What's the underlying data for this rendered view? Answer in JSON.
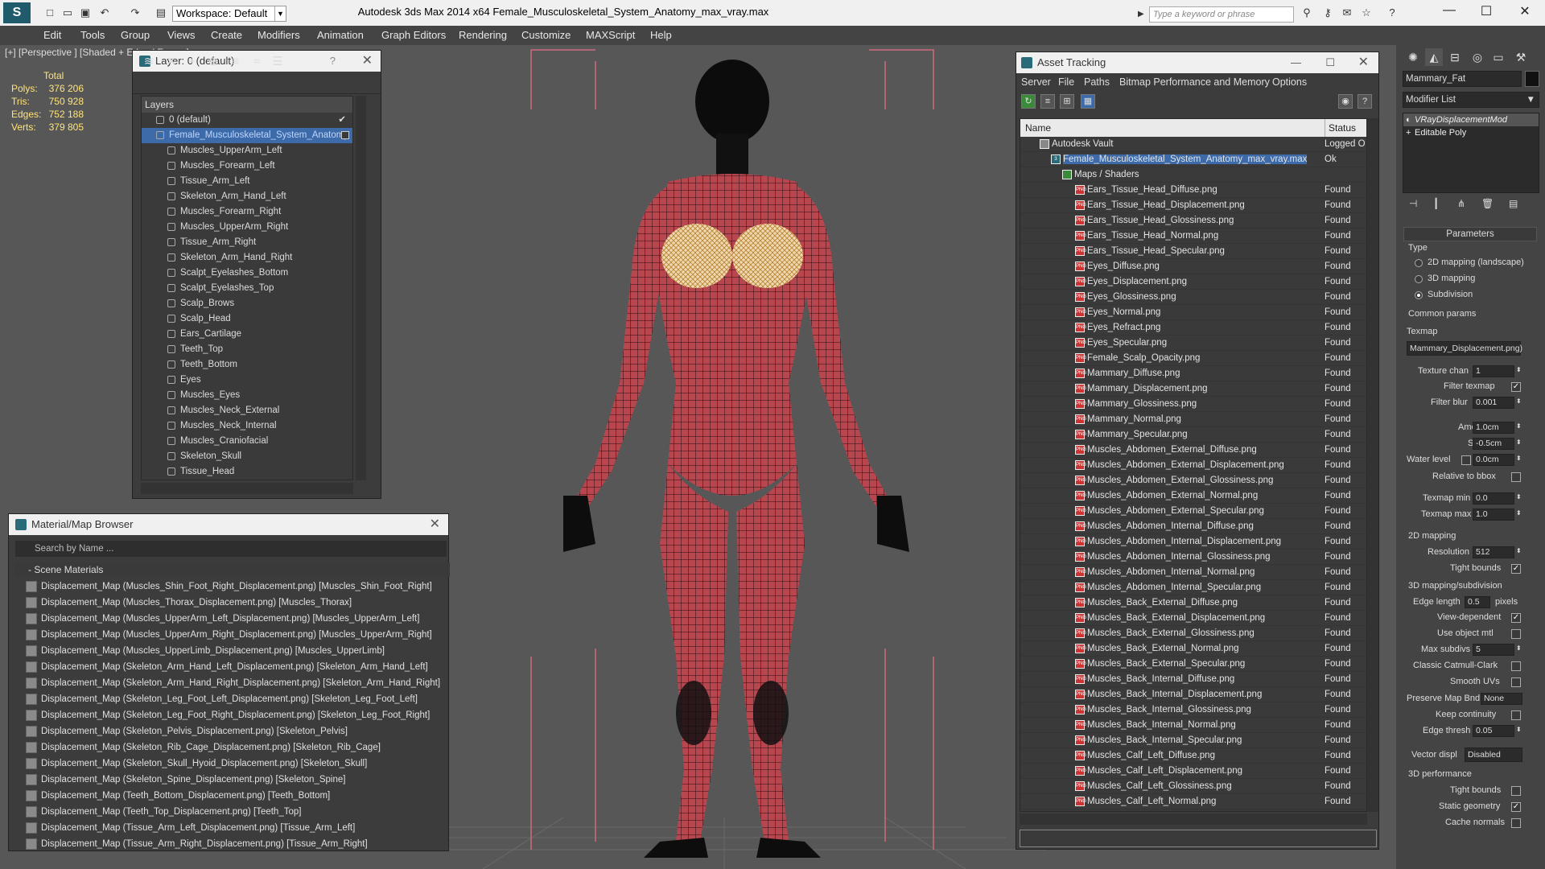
{
  "app": {
    "title": "Autodesk 3ds Max  2014 x64     Female_Musculoskeletal_System_Anatomy_max_vray.max",
    "workspace": "Workspace: Default",
    "search_placeholder": "Type a keyword or phrase"
  },
  "menu": [
    "Edit",
    "Tools",
    "Group",
    "Views",
    "Create",
    "Modifiers",
    "Animation",
    "Graph Editors",
    "Rendering",
    "Customize",
    "MAXScript",
    "Help"
  ],
  "viewport": {
    "label": "[+] [Perspective ] [Shaded + Edged Faces ]",
    "stats": {
      "header": "Total",
      "rows": [
        {
          "label": "Polys:",
          "value": "376 206"
        },
        {
          "label": "Tris:",
          "value": "750 928"
        },
        {
          "label": "Edges:",
          "value": "752 188"
        },
        {
          "label": "Verts:",
          "value": "379 805"
        }
      ]
    }
  },
  "layer_panel": {
    "title": "Layer: 0 (default)",
    "help": "?",
    "header": "Layers",
    "items": [
      {
        "label": "0 (default)",
        "level": 1,
        "checked": true
      },
      {
        "label": "Female_Musculoskeletal_System_Anatomy",
        "level": 1,
        "selected": true
      },
      {
        "label": "Muscles_UpperArm_Left",
        "level": 2
      },
      {
        "label": "Muscles_Forearm_Left",
        "level": 2
      },
      {
        "label": "Tissue_Arm_Left",
        "level": 2
      },
      {
        "label": "Skeleton_Arm_Hand_Left",
        "level": 2
      },
      {
        "label": "Muscles_Forearm_Right",
        "level": 2
      },
      {
        "label": "Muscles_UpperArm_Right",
        "level": 2
      },
      {
        "label": "Tissue_Arm_Right",
        "level": 2
      },
      {
        "label": "Skeleton_Arm_Hand_Right",
        "level": 2
      },
      {
        "label": "Scalpt_Eyelashes_Bottom",
        "level": 2
      },
      {
        "label": "Scalpt_Eyelashes_Top",
        "level": 2
      },
      {
        "label": "Scalp_Brows",
        "level": 2
      },
      {
        "label": "Scalp_Head",
        "level": 2
      },
      {
        "label": "Ears_Cartilage",
        "level": 2
      },
      {
        "label": "Teeth_Top",
        "level": 2
      },
      {
        "label": "Teeth_Bottom",
        "level": 2
      },
      {
        "label": "Eyes",
        "level": 2
      },
      {
        "label": "Muscles_Eyes",
        "level": 2
      },
      {
        "label": "Muscles_Neck_External",
        "level": 2
      },
      {
        "label": "Muscles_Neck_Internal",
        "level": 2
      },
      {
        "label": "Muscles_Craniofacial",
        "level": 2
      },
      {
        "label": "Skeleton_Skull",
        "level": 2
      },
      {
        "label": "Tissue_Head",
        "level": 2
      }
    ]
  },
  "material_browser": {
    "title": "Material/Map Browser",
    "search_placeholder": "Search by Name ...",
    "section": "Scene Materials",
    "items": [
      "Displacement_Map (Muscles_Shin_Foot_Right_Displacement.png) [Muscles_Shin_Foot_Right]",
      "Displacement_Map (Muscles_Thorax_Displacement.png) [Muscles_Thorax]",
      "Displacement_Map (Muscles_UpperArm_Left_Displacement.png) [Muscles_UpperArm_Left]",
      "Displacement_Map (Muscles_UpperArm_Right_Displacement.png) [Muscles_UpperArm_Right]",
      "Displacement_Map (Muscles_UpperLimb_Displacement.png) [Muscles_UpperLimb]",
      "Displacement_Map (Skeleton_Arm_Hand_Left_Displacement.png) [Skeleton_Arm_Hand_Left]",
      "Displacement_Map (Skeleton_Arm_Hand_Right_Displacement.png) [Skeleton_Arm_Hand_Right]",
      "Displacement_Map (Skeleton_Leg_Foot_Left_Displacement.png) [Skeleton_Leg_Foot_Left]",
      "Displacement_Map (Skeleton_Leg_Foot_Right_Displacement.png) [Skeleton_Leg_Foot_Right]",
      "Displacement_Map (Skeleton_Pelvis_Displacement.png) [Skeleton_Pelvis]",
      "Displacement_Map (Skeleton_Rib_Cage_Displacement.png) [Skeleton_Rib_Cage]",
      "Displacement_Map (Skeleton_Skull_Hyoid_Displacement.png) [Skeleton_Skull]",
      "Displacement_Map (Skeleton_Spine_Displacement.png) [Skeleton_Spine]",
      "Displacement_Map (Teeth_Bottom_Displacement.png) [Teeth_Bottom]",
      "Displacement_Map (Teeth_Top_Displacement.png) [Teeth_Top]",
      "Displacement_Map (Tissue_Arm_Left_Displacement.png) [Tissue_Arm_Left]",
      "Displacement_Map (Tissue_Arm_Right_Displacement.png) [Tissue_Arm_Right]"
    ]
  },
  "asset_tracking": {
    "title": "Asset Tracking",
    "menu": [
      "Server",
      "File",
      "Paths",
      "Bitmap Performance and Memory",
      "Options"
    ],
    "columns": {
      "name": "Name",
      "status": "Status"
    },
    "rows": [
      {
        "name": "Autodesk Vault",
        "status": "Logged O",
        "level": 1,
        "icon": "vault"
      },
      {
        "name": "Female_Musculoskeletal_System_Anatomy_max_vray.max",
        "status": "Ok",
        "level": 2,
        "icon": "max",
        "selected": true
      },
      {
        "name": "Maps / Shaders",
        "status": "",
        "level": 3,
        "icon": "folder"
      },
      {
        "name": "Ears_Tissue_Head_Diffuse.png",
        "status": "Found",
        "level": 4,
        "icon": "png"
      },
      {
        "name": "Ears_Tissue_Head_Displacement.png",
        "status": "Found",
        "level": 4,
        "icon": "png"
      },
      {
        "name": "Ears_Tissue_Head_Glossiness.png",
        "status": "Found",
        "level": 4,
        "icon": "png"
      },
      {
        "name": "Ears_Tissue_Head_Normal.png",
        "status": "Found",
        "level": 4,
        "icon": "png"
      },
      {
        "name": "Ears_Tissue_Head_Specular.png",
        "status": "Found",
        "level": 4,
        "icon": "png"
      },
      {
        "name": "Eyes_Diffuse.png",
        "status": "Found",
        "level": 4,
        "icon": "png"
      },
      {
        "name": "Eyes_Displacement.png",
        "status": "Found",
        "level": 4,
        "icon": "png"
      },
      {
        "name": "Eyes_Glossiness.png",
        "status": "Found",
        "level": 4,
        "icon": "png"
      },
      {
        "name": "Eyes_Normal.png",
        "status": "Found",
        "level": 4,
        "icon": "png"
      },
      {
        "name": "Eyes_Refract.png",
        "status": "Found",
        "level": 4,
        "icon": "png"
      },
      {
        "name": "Eyes_Specular.png",
        "status": "Found",
        "level": 4,
        "icon": "png"
      },
      {
        "name": "Female_Scalp_Opacity.png",
        "status": "Found",
        "level": 4,
        "icon": "png"
      },
      {
        "name": "Mammary_Diffuse.png",
        "status": "Found",
        "level": 4,
        "icon": "png"
      },
      {
        "name": "Mammary_Displacement.png",
        "status": "Found",
        "level": 4,
        "icon": "png"
      },
      {
        "name": "Mammary_Glossiness.png",
        "status": "Found",
        "level": 4,
        "icon": "png"
      },
      {
        "name": "Mammary_Normal.png",
        "status": "Found",
        "level": 4,
        "icon": "png"
      },
      {
        "name": "Mammary_Specular.png",
        "status": "Found",
        "level": 4,
        "icon": "png"
      },
      {
        "name": "Muscles_Abdomen_External_Diffuse.png",
        "status": "Found",
        "level": 4,
        "icon": "png"
      },
      {
        "name": "Muscles_Abdomen_External_Displacement.png",
        "status": "Found",
        "level": 4,
        "icon": "png"
      },
      {
        "name": "Muscles_Abdomen_External_Glossiness.png",
        "status": "Found",
        "level": 4,
        "icon": "png"
      },
      {
        "name": "Muscles_Abdomen_External_Normal.png",
        "status": "Found",
        "level": 4,
        "icon": "png"
      },
      {
        "name": "Muscles_Abdomen_External_Specular.png",
        "status": "Found",
        "level": 4,
        "icon": "png"
      },
      {
        "name": "Muscles_Abdomen_Internal_Diffuse.png",
        "status": "Found",
        "level": 4,
        "icon": "png"
      },
      {
        "name": "Muscles_Abdomen_Internal_Displacement.png",
        "status": "Found",
        "level": 4,
        "icon": "png"
      },
      {
        "name": "Muscles_Abdomen_Internal_Glossiness.png",
        "status": "Found",
        "level": 4,
        "icon": "png"
      },
      {
        "name": "Muscles_Abdomen_Internal_Normal.png",
        "status": "Found",
        "level": 4,
        "icon": "png"
      },
      {
        "name": "Muscles_Abdomen_Internal_Specular.png",
        "status": "Found",
        "level": 4,
        "icon": "png"
      },
      {
        "name": "Muscles_Back_External_Diffuse.png",
        "status": "Found",
        "level": 4,
        "icon": "png"
      },
      {
        "name": "Muscles_Back_External_Displacement.png",
        "status": "Found",
        "level": 4,
        "icon": "png"
      },
      {
        "name": "Muscles_Back_External_Glossiness.png",
        "status": "Found",
        "level": 4,
        "icon": "png"
      },
      {
        "name": "Muscles_Back_External_Normal.png",
        "status": "Found",
        "level": 4,
        "icon": "png"
      },
      {
        "name": "Muscles_Back_External_Specular.png",
        "status": "Found",
        "level": 4,
        "icon": "png"
      },
      {
        "name": "Muscles_Back_Internal_Diffuse.png",
        "status": "Found",
        "level": 4,
        "icon": "png"
      },
      {
        "name": "Muscles_Back_Internal_Displacement.png",
        "status": "Found",
        "level": 4,
        "icon": "png"
      },
      {
        "name": "Muscles_Back_Internal_Glossiness.png",
        "status": "Found",
        "level": 4,
        "icon": "png"
      },
      {
        "name": "Muscles_Back_Internal_Normal.png",
        "status": "Found",
        "level": 4,
        "icon": "png"
      },
      {
        "name": "Muscles_Back_Internal_Specular.png",
        "status": "Found",
        "level": 4,
        "icon": "png"
      },
      {
        "name": "Muscles_Calf_Left_Diffuse.png",
        "status": "Found",
        "level": 4,
        "icon": "png"
      },
      {
        "name": "Muscles_Calf_Left_Displacement.png",
        "status": "Found",
        "level": 4,
        "icon": "png"
      },
      {
        "name": "Muscles_Calf_Left_Glossiness.png",
        "status": "Found",
        "level": 4,
        "icon": "png"
      },
      {
        "name": "Muscles_Calf_Left_Normal.png",
        "status": "Found",
        "level": 4,
        "icon": "png"
      }
    ]
  },
  "command_panel": {
    "object_name": "Mammary_Fat",
    "modifier_list": "Modifier List",
    "stack": [
      "VRayDisplacementMod",
      "Editable Poly"
    ],
    "parameters_title": "Parameters",
    "type_label": "Type",
    "type_options": [
      {
        "label": "2D mapping (landscape)",
        "on": false
      },
      {
        "label": "3D mapping",
        "on": false
      },
      {
        "label": "Subdivision",
        "on": true
      }
    ],
    "common_params": "Common params",
    "texmap_label": "Texmap",
    "texmap_value": "Mammary_Displacement.png)",
    "texture_chan": {
      "label": "Texture chan",
      "value": "1"
    },
    "filter_texmap": {
      "label": "Filter texmap",
      "checked": true
    },
    "filter_blur": {
      "label": "Filter blur",
      "value": "0.001"
    },
    "amount": {
      "label": "Amount",
      "value": "1.0cm"
    },
    "shift": {
      "label": "Shift",
      "value": "-0.5cm"
    },
    "water_level": {
      "label": "Water level",
      "value": "0.0cm"
    },
    "relative_bbox": {
      "label": "Relative to bbox",
      "checked": false
    },
    "texmap_min": {
      "label": "Texmap min",
      "value": "0.0"
    },
    "texmap_max": {
      "label": "Texmap max",
      "value": "1.0"
    },
    "mapping_2d": "2D mapping",
    "resolution": {
      "label": "Resolution",
      "value": "512"
    },
    "tight_bounds": {
      "label": "Tight bounds",
      "checked": true
    },
    "mapping_3d": "3D mapping/subdivision",
    "edge_length": {
      "label": "Edge length",
      "value": "0.5",
      "unit": "pixels"
    },
    "view_dependent": {
      "label": "View-dependent",
      "checked": true
    },
    "use_object_mtl": {
      "label": "Use object mtl",
      "checked": false
    },
    "max_subdivs": {
      "label": "Max subdivs",
      "value": "5"
    },
    "catmull": {
      "label": "Classic Catmull-Clark",
      "checked": false
    },
    "smooth_uvs": {
      "label": "Smooth UVs",
      "checked": false
    },
    "preserve_map": {
      "label": "Preserve Map Bnd",
      "value": "None"
    },
    "keep_continuity": {
      "label": "Keep continuity",
      "checked": false
    },
    "edge_thresh": {
      "label": "Edge thresh",
      "value": "0.05"
    },
    "vector_displ": {
      "label": "Vector displ",
      "value": "Disabled"
    },
    "perf_3d": "3D performance",
    "tight_bounds2": {
      "label": "Tight bounds",
      "checked": false
    },
    "static_geometry": {
      "label": "Static geometry",
      "checked": true
    },
    "cache_normals": {
      "label": "Cache normals",
      "checked": false
    }
  }
}
